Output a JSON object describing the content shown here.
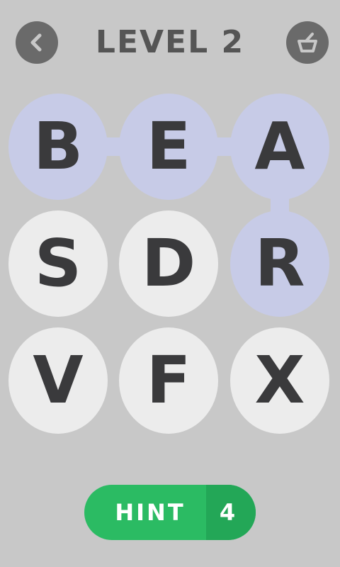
{
  "header": {
    "title": "LEVEL 2",
    "back_icon": "chevron-left-icon",
    "shop_icon": "basket-icon"
  },
  "grid": {
    "tiles": [
      {
        "letter": "B",
        "selected": true
      },
      {
        "letter": "E",
        "selected": true
      },
      {
        "letter": "A",
        "selected": true
      },
      {
        "letter": "S",
        "selected": false
      },
      {
        "letter": "D",
        "selected": false
      },
      {
        "letter": "R",
        "selected": true
      },
      {
        "letter": "V",
        "selected": false
      },
      {
        "letter": "F",
        "selected": false
      },
      {
        "letter": "X",
        "selected": false
      }
    ]
  },
  "hint": {
    "label": "HINT",
    "count": "4"
  },
  "colors": {
    "background": "#c8c8c8",
    "tile": "#ececec",
    "tile_selected": "#c7cbe7",
    "letter": "#3a3a3c",
    "hint_green": "#2bbb63",
    "hint_green_dark": "#23a757"
  }
}
